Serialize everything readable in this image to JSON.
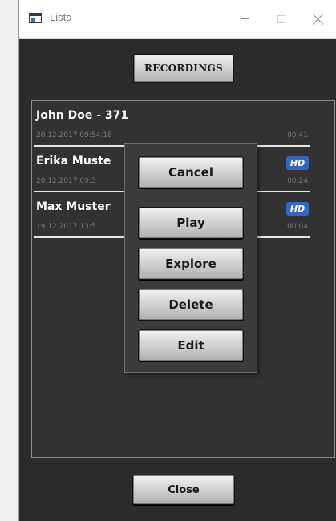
{
  "window": {
    "title": "Lists",
    "app_icon": "app-window-icon",
    "controls": [
      "minimize-icon",
      "maximize-icon",
      "close-icon"
    ]
  },
  "toolbar": {
    "recordings_label": "RECORDINGS"
  },
  "recordings": [
    {
      "name": "John Doe - 371",
      "date": "20.12.2017 09:54:18",
      "duration": "00:41",
      "hd": ""
    },
    {
      "name": "Erika Muste",
      "date": "20.12.2017 09:3",
      "duration": "00:24",
      "hd": "HD"
    },
    {
      "name": "Max Muster",
      "date": "19.12.2017 13:5",
      "duration": "00:04",
      "hd": "HD"
    }
  ],
  "context_menu": {
    "cancel": "Cancel",
    "play": "Play",
    "explore": "Explore",
    "delete": "Delete",
    "edit": "Edit"
  },
  "footer": {
    "close_label": "Close"
  },
  "colors": {
    "background": "#2b2b2b",
    "list_background": "#323232",
    "hd_badge": "#3566c2",
    "separator": "#e6e6e6"
  }
}
